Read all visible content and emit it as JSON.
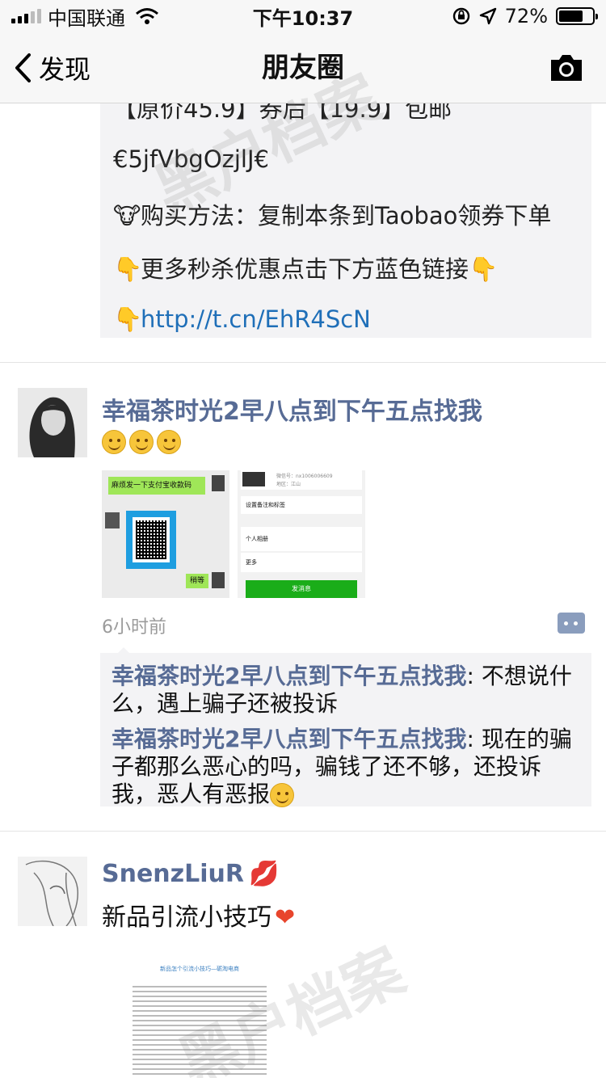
{
  "status_bar": {
    "carrier": "中国联通",
    "time": "下午10:37",
    "battery": "72%",
    "battery_level": 0.72
  },
  "nav": {
    "back_label": "发现",
    "title": "朋友圈"
  },
  "shared_post": {
    "line_partial": "【原价45.9】券后【19.9】包邮",
    "code": "€5jfVbgOzjlJ€",
    "buy_method": "购买方法：复制本条到Taobao领券下单",
    "more_deals": "更多秒杀优惠点击下方蓝色链接",
    "link": "http://t.cn/EhR4ScN"
  },
  "post1": {
    "author": "幸福茶时光2早八点到下午五点找我",
    "image1": {
      "bubble_text": "麻烦发一下支付宝收款码",
      "reply_text": "稍等"
    },
    "image2": {
      "header_line1": "微信号：nx1006006609",
      "header_line2": "地区：江山",
      "row1": "设置备注和标签",
      "row2": "个人相册",
      "row3": "更多",
      "button": "发消息"
    },
    "timestamp": "6小时前",
    "comments": [
      {
        "author": "幸福茶时光2早八点到下午五点找我",
        "text": ": 不想说什么，遇上骗子还被投诉"
      },
      {
        "author": "幸福茶时光2早八点到下午五点找我",
        "text": ": 现在的骗子都那么恶心的吗，骗钱了还不够，还投诉我，恶人有恶报"
      }
    ]
  },
  "post2": {
    "author": "SnenzLiuR",
    "text": "新品引流小技巧",
    "doc_title": "新品怎个引流小技巧—砺淘电商"
  },
  "watermark": "黑户档案",
  "colors": {
    "link_blue": "#1f6fb8",
    "nickname_blue": "#576b95",
    "comment_bg": "#f3f3f5",
    "wechat_green": "#1aad19"
  }
}
